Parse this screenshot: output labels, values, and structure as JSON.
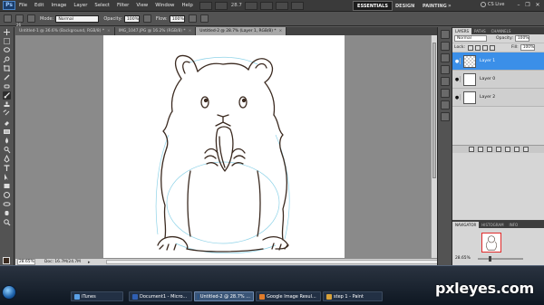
{
  "app": {
    "logo": "Ps",
    "menu": [
      "File",
      "Edit",
      "Image",
      "Layer",
      "Select",
      "Filter",
      "View",
      "Window",
      "Help"
    ],
    "zoom": "28.7",
    "workspaces": {
      "essentials": "ESSENTIALS",
      "design": "DESIGN",
      "painting": "PAINTING",
      "more": "»"
    },
    "cs_live": "CS Live",
    "window_controls": {
      "minimize": "–",
      "restore": "❐",
      "close": "✕"
    }
  },
  "options": {
    "mode_label": "Mode:",
    "mode_value": "Normal",
    "opacity_label": "Opacity:",
    "opacity_value": "100%",
    "flow_label": "Flow:",
    "flow_value": "100%",
    "brush_size": "26"
  },
  "document_tabs": [
    {
      "label": "Untitled-1 @ 36.6% (Background, RGB/8) *",
      "close": "×"
    },
    {
      "label": "IMG_1047.JPG @ 16.2% (RGB/8) *",
      "close": "×"
    },
    {
      "label": "Untitled-2 @ 28.7% (Layer 1, RGB/8) *",
      "close": "×"
    }
  ],
  "status": {
    "zoom": "28.65%",
    "doc": "Doc: 16.7M/24.7M",
    "arrow": "▸"
  },
  "layers_panel": {
    "tabs": [
      "LAYERS",
      "PATHS",
      "CHANNELS"
    ],
    "blend_mode": "Normal",
    "opacity_label": "Opacity:",
    "opacity_value": "100%",
    "lock_label": "Lock:",
    "fill_label": "Fill:",
    "fill_value": "100%",
    "layers": [
      {
        "name": "Layer 1",
        "active": true
      },
      {
        "name": "Layer 0",
        "active": false
      },
      {
        "name": "Layer 2",
        "active": false
      }
    ]
  },
  "navigator": {
    "tabs": [
      "NAVIGATOR",
      "HISTOGRAM",
      "INFO"
    ],
    "zoom": "28.65%"
  },
  "taskbar": {
    "items": [
      {
        "label": "iTunes",
        "color": "#5aa0e6"
      },
      {
        "label": "Document1 - Micro...",
        "color": "#2f5fb3"
      },
      {
        "label": "Untitled-2 @ 28.7% ...",
        "color": "#1e4f8a"
      },
      {
        "label": "Google Image Resul...",
        "color": "#e07b2a"
      },
      {
        "label": "step 1 - Paint",
        "color": "#d8a23a"
      }
    ],
    "watermark": "pxleyes.com"
  },
  "colors": {
    "accent": "#3b8fe8",
    "sketch_stroke": "#3b2a20",
    "guide_stroke": "#8fd3e8"
  }
}
